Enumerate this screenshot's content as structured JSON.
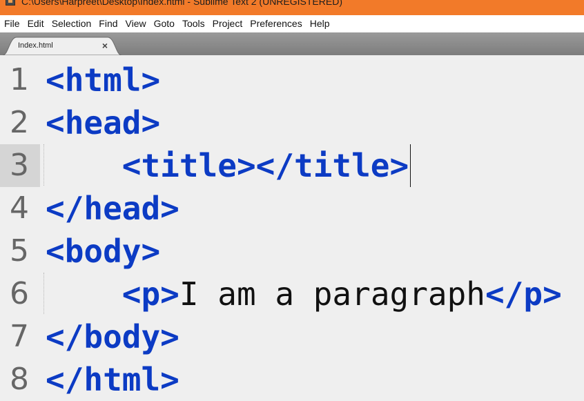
{
  "window": {
    "title": "C:\\Users\\Harpreet\\Desktop\\Index.html - Sublime Text 2 (UNREGISTERED)",
    "icon": "sublime-text-icon",
    "title_bar_color": "#f27a29"
  },
  "menu": {
    "items": [
      "File",
      "Edit",
      "Selection",
      "Find",
      "View",
      "Goto",
      "Tools",
      "Project",
      "Preferences",
      "Help"
    ]
  },
  "tabs": [
    {
      "label": "Index.html",
      "close_label": "×",
      "active": true
    }
  ],
  "editor": {
    "active_line": 3,
    "tag_color": "#0c3bc4",
    "lines": [
      {
        "number": "1",
        "indent": "",
        "segments": [
          {
            "type": "tag",
            "text": "<html>"
          }
        ]
      },
      {
        "number": "2",
        "indent": "",
        "segments": [
          {
            "type": "tag",
            "text": "<head>"
          }
        ]
      },
      {
        "number": "3",
        "indent": "    ",
        "segments": [
          {
            "type": "tag",
            "text": "<title></title>"
          }
        ]
      },
      {
        "number": "4",
        "indent": "",
        "segments": [
          {
            "type": "tag",
            "text": "</head>"
          }
        ]
      },
      {
        "number": "5",
        "indent": "",
        "segments": [
          {
            "type": "tag",
            "text": "<body>"
          }
        ]
      },
      {
        "number": "6",
        "indent": "    ",
        "segments": [
          {
            "type": "tag",
            "text": "<p>"
          },
          {
            "type": "text",
            "text": "I am a paragraph"
          },
          {
            "type": "tag",
            "text": "</p>"
          }
        ]
      },
      {
        "number": "7",
        "indent": "",
        "segments": [
          {
            "type": "tag",
            "text": "</body>"
          }
        ]
      },
      {
        "number": "8",
        "indent": "",
        "segments": [
          {
            "type": "tag",
            "text": "</html>"
          }
        ]
      }
    ]
  }
}
